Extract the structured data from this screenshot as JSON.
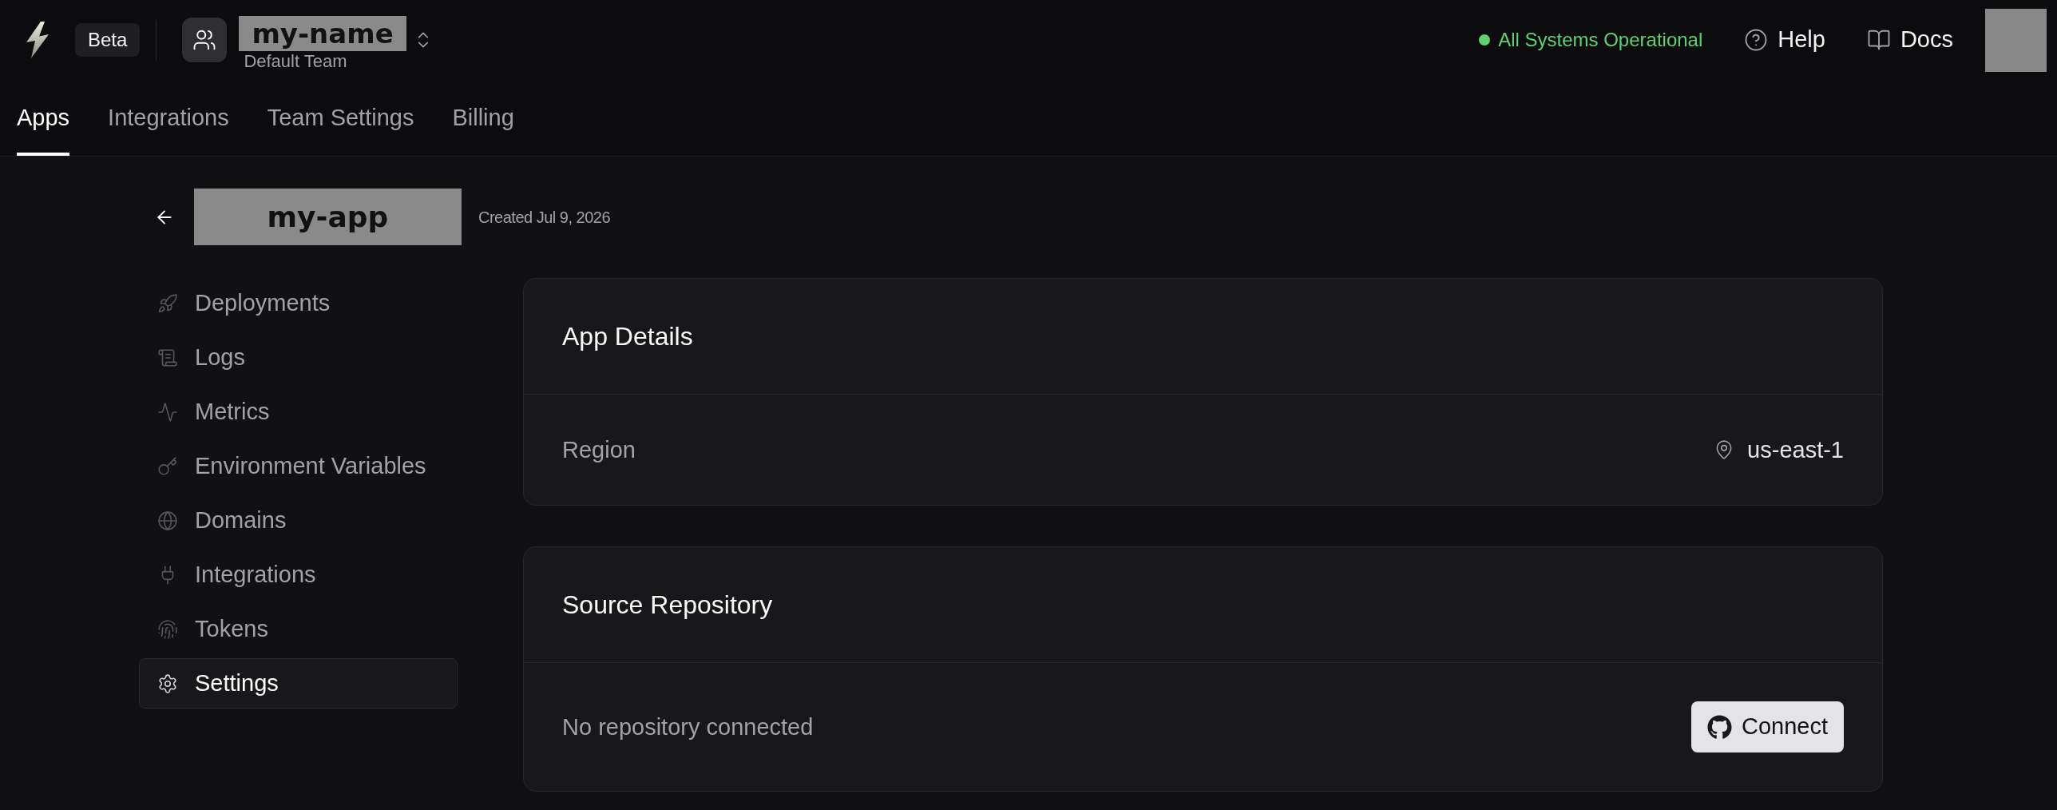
{
  "header": {
    "badge": "Beta",
    "team": {
      "name": "my-name",
      "subtitle": "Default Team"
    },
    "status": "All Systems Operational",
    "links": [
      {
        "label": "Help"
      },
      {
        "label": "Docs"
      }
    ]
  },
  "tabs": [
    {
      "label": "Apps",
      "selected": true
    },
    {
      "label": "Integrations",
      "selected": false
    },
    {
      "label": "Team Settings",
      "selected": false
    },
    {
      "label": "Billing",
      "selected": false
    }
  ],
  "app": {
    "name": "my-app",
    "created": "Created Jul 9, 2026"
  },
  "sidebar": {
    "items": [
      {
        "label": "Deployments",
        "selected": false
      },
      {
        "label": "Logs",
        "selected": false
      },
      {
        "label": "Metrics",
        "selected": false
      },
      {
        "label": "Environment Variables",
        "selected": false
      },
      {
        "label": "Domains",
        "selected": false
      },
      {
        "label": "Integrations",
        "selected": false
      },
      {
        "label": "Tokens",
        "selected": false
      },
      {
        "label": "Settings",
        "selected": true
      }
    ]
  },
  "cards": [
    {
      "title": "App Details",
      "rows": [
        {
          "kind": "value",
          "label": "Region",
          "value": "us-east-1"
        }
      ]
    },
    {
      "title": "Source Repository",
      "rows": [
        {
          "kind": "action",
          "label": "No repository connected",
          "action": "Connect"
        }
      ]
    }
  ]
}
